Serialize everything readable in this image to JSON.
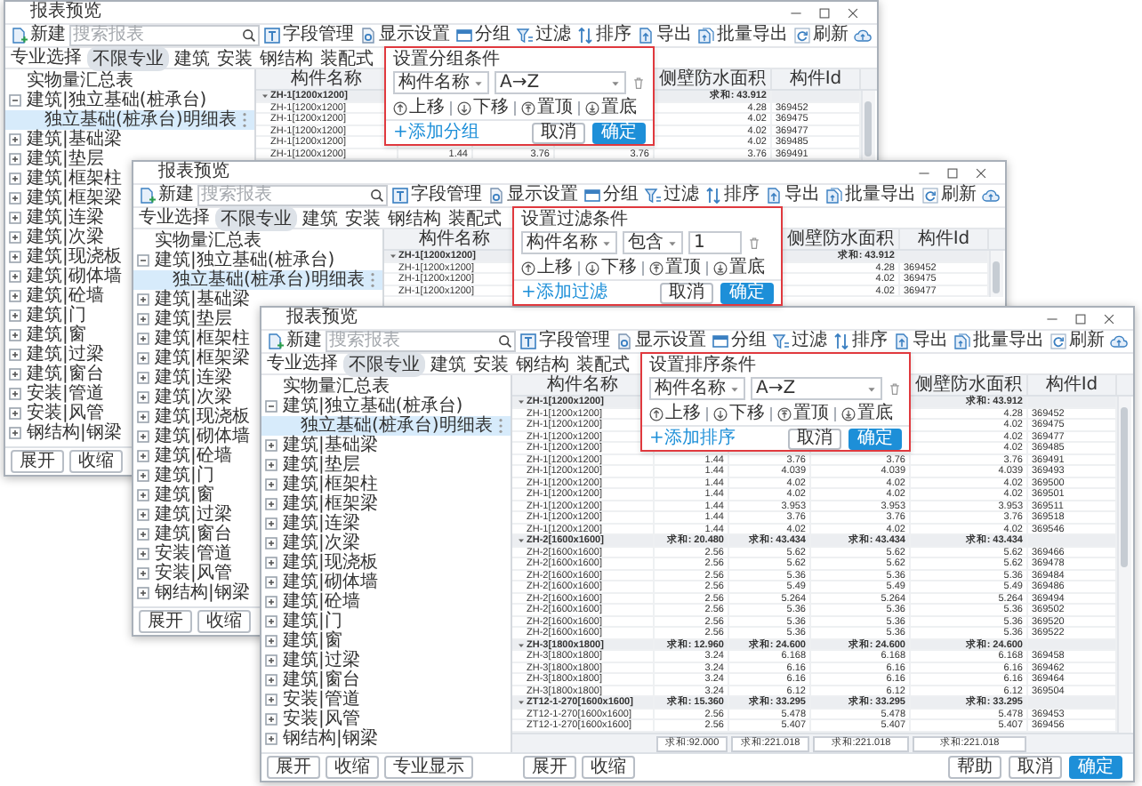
{
  "windows": [
    {
      "title": "报表预览",
      "toolbar": {
        "new_label": "新建",
        "search_placeholder": "搜索报表",
        "buttons": [
          {
            "kind": "fields",
            "label": "字段管理"
          },
          {
            "kind": "display",
            "label": "显示设置"
          },
          {
            "kind": "group",
            "label": "分组"
          },
          {
            "kind": "filter",
            "label": "过滤"
          },
          {
            "kind": "sort",
            "label": "排序"
          },
          {
            "kind": "export",
            "label": "导出"
          },
          {
            "kind": "batch_export",
            "label": "批量导出"
          },
          {
            "kind": "refresh",
            "label": "刷新"
          },
          {
            "kind": "upload"
          }
        ]
      },
      "discipline_label": "专业选择",
      "tabs": [
        {
          "label": "不限专业",
          "selected": true
        },
        {
          "label": "建筑",
          "selected": false
        },
        {
          "label": "安装",
          "selected": false
        },
        {
          "label": "钢结构",
          "selected": false
        },
        {
          "label": "装配式",
          "selected": false
        }
      ],
      "tree": [
        {
          "label": "实物量汇总表",
          "selected": false
        },
        {
          "label": "建筑|独立基础(桩承台)",
          "selected": false,
          "expanded": true,
          "children": [
            {
              "label": "独立基础(桩承台)明细表",
              "selected": true
            }
          ]
        },
        {
          "label": "建筑|基础梁",
          "selected": false,
          "expanded": false
        },
        {
          "label": "建筑|垫层",
          "selected": false,
          "expanded": false
        },
        {
          "label": "建筑|框架柱",
          "selected": false,
          "expanded": false
        },
        {
          "label": "建筑|框架梁",
          "selected": false,
          "expanded": false
        },
        {
          "label": "建筑|连梁",
          "selected": false,
          "expanded": false
        },
        {
          "label": "建筑|次梁",
          "selected": false,
          "expanded": false
        },
        {
          "label": "建筑|现浇板",
          "selected": false,
          "expanded": false
        },
        {
          "label": "建筑|砌体墙",
          "selected": false,
          "expanded": false
        },
        {
          "label": "建筑|砼墙",
          "selected": false,
          "expanded": false
        },
        {
          "label": "建筑|门",
          "selected": false,
          "expanded": false
        },
        {
          "label": "建筑|窗",
          "selected": false,
          "expanded": false
        },
        {
          "label": "建筑|过梁",
          "selected": false,
          "expanded": false
        },
        {
          "label": "建筑|窗台",
          "selected": false,
          "expanded": false
        },
        {
          "label": "安装|管道",
          "selected": false,
          "expanded": false
        },
        {
          "label": "安装|风管",
          "selected": false,
          "expanded": false
        },
        {
          "label": "钢结构|钢梁",
          "selected": false,
          "expanded": false
        }
      ],
      "table": {
        "columns": [
          "构件名称",
          null,
          null,
          null,
          "侧壁防水面积",
          "构件Id"
        ],
        "rows": [
          {
            "kind": "group",
            "cells": [
              "ZH-1[1200x1200]",
              null,
              null,
              null,
              "求和: 43.912",
              null
            ]
          },
          {
            "kind": "item",
            "cells": [
              "ZH-1[1200x1200]",
              null,
              null,
              null,
              "4.28",
              "369452"
            ]
          },
          {
            "kind": "item",
            "cells": [
              "ZH-1[1200x1200]",
              null,
              null,
              null,
              "4.02",
              "369475"
            ]
          },
          {
            "kind": "item",
            "cells": [
              "ZH-1[1200x1200]",
              null,
              null,
              null,
              "4.02",
              "369477"
            ]
          },
          {
            "kind": "item",
            "cells": [
              "ZH-1[1200x1200]",
              null,
              null,
              null,
              "4.02",
              "369485"
            ]
          },
          {
            "kind": "item",
            "cells": [
              "ZH-1[1200x1200]",
              "1.44",
              "3.76",
              "3.76",
              "3.76",
              "369491"
            ]
          }
        ]
      },
      "popup": {
        "kind": "group",
        "title": "设置分组条件",
        "field": "构件名称",
        "order": "A→Z",
        "actions": [
          "上移",
          "下移",
          "置顶",
          "置底"
        ],
        "add_link": "+添加分组",
        "cancel": "取消",
        "confirm": "确定"
      },
      "bottom_buttons": {
        "tree": [
          "展开",
          "收缩"
        ]
      }
    },
    {
      "title": "报表预览",
      "toolbar": {
        "new_label": "新建",
        "search_placeholder": "搜索报表",
        "buttons": [
          {
            "kind": "fields",
            "label": "字段管理"
          },
          {
            "kind": "display",
            "label": "显示设置"
          },
          {
            "kind": "group",
            "label": "分组"
          },
          {
            "kind": "filter",
            "label": "过滤"
          },
          {
            "kind": "sort",
            "label": "排序"
          },
          {
            "kind": "export",
            "label": "导出"
          },
          {
            "kind": "batch_export",
            "label": "批量导出"
          },
          {
            "kind": "refresh",
            "label": "刷新"
          },
          {
            "kind": "upload"
          }
        ]
      },
      "discipline_label": "专业选择",
      "tabs": [
        {
          "label": "不限专业",
          "selected": true
        },
        {
          "label": "建筑",
          "selected": false
        },
        {
          "label": "安装",
          "selected": false
        },
        {
          "label": "钢结构",
          "selected": false
        },
        {
          "label": "装配式",
          "selected": false
        }
      ],
      "tree": [
        {
          "label": "实物量汇总表",
          "selected": false
        },
        {
          "label": "建筑|独立基础(桩承台)",
          "selected": false,
          "expanded": true,
          "children": [
            {
              "label": "独立基础(桩承台)明细表",
              "selected": true
            }
          ]
        },
        {
          "label": "建筑|基础梁",
          "selected": false,
          "expanded": false
        },
        {
          "label": "建筑|垫层",
          "selected": false,
          "expanded": false
        },
        {
          "label": "建筑|框架柱",
          "selected": false,
          "expanded": false
        },
        {
          "label": "建筑|框架梁",
          "selected": false,
          "expanded": false
        },
        {
          "label": "建筑|连梁",
          "selected": false,
          "expanded": false
        },
        {
          "label": "建筑|次梁",
          "selected": false,
          "expanded": false
        },
        {
          "label": "建筑|现浇板",
          "selected": false,
          "expanded": false
        },
        {
          "label": "建筑|砌体墙",
          "selected": false,
          "expanded": false
        },
        {
          "label": "建筑|砼墙",
          "selected": false,
          "expanded": false
        },
        {
          "label": "建筑|门",
          "selected": false,
          "expanded": false
        },
        {
          "label": "建筑|窗",
          "selected": false,
          "expanded": false
        },
        {
          "label": "建筑|过梁",
          "selected": false,
          "expanded": false
        },
        {
          "label": "建筑|窗台",
          "selected": false,
          "expanded": false
        },
        {
          "label": "安装|管道",
          "selected": false,
          "expanded": false
        },
        {
          "label": "安装|风管",
          "selected": false,
          "expanded": false
        },
        {
          "label": "钢结构|钢梁",
          "selected": false,
          "expanded": false
        }
      ],
      "table": {
        "columns": [
          "构件名称",
          null,
          null,
          null,
          "侧壁防水面积",
          "构件Id"
        ],
        "rows": [
          {
            "kind": "group",
            "cells": [
              "ZH-1[1200x1200]",
              null,
              null,
              null,
              "求和: 43.912",
              null
            ]
          },
          {
            "kind": "item",
            "cells": [
              "ZH-1[1200x1200]",
              null,
              null,
              null,
              "4.28",
              "369452"
            ]
          },
          {
            "kind": "item",
            "cells": [
              "ZH-1[1200x1200]",
              null,
              null,
              null,
              "4.02",
              "369475"
            ]
          },
          {
            "kind": "item",
            "cells": [
              "ZH-1[1200x1200]",
              null,
              null,
              null,
              "4.02",
              "369477"
            ]
          }
        ]
      },
      "popup": {
        "kind": "filter",
        "title": "设置过滤条件",
        "field": "构件名称",
        "operator": "包含",
        "value": "1",
        "actions": [
          "上移",
          "下移",
          "置顶",
          "置底"
        ],
        "add_link": "+添加过滤",
        "cancel": "取消",
        "confirm": "确定"
      },
      "bottom_buttons": {
        "tree": [
          "展开",
          "收缩"
        ]
      }
    },
    {
      "title": "报表预览",
      "toolbar": {
        "new_label": "新建",
        "search_placeholder": "搜索报表",
        "buttons": [
          {
            "kind": "fields",
            "label": "字段管理"
          },
          {
            "kind": "display",
            "label": "显示设置"
          },
          {
            "kind": "group",
            "label": "分组"
          },
          {
            "kind": "filter",
            "label": "过滤"
          },
          {
            "kind": "sort",
            "label": "排序"
          },
          {
            "kind": "export",
            "label": "导出"
          },
          {
            "kind": "batch_export",
            "label": "批量导出"
          },
          {
            "kind": "refresh",
            "label": "刷新"
          },
          {
            "kind": "upload"
          }
        ]
      },
      "discipline_label": "专业选择",
      "tabs": [
        {
          "label": "不限专业",
          "selected": true
        },
        {
          "label": "建筑",
          "selected": false
        },
        {
          "label": "安装",
          "selected": false
        },
        {
          "label": "钢结构",
          "selected": false
        },
        {
          "label": "装配式",
          "selected": false
        }
      ],
      "tree": [
        {
          "label": "实物量汇总表",
          "selected": false
        },
        {
          "label": "建筑|独立基础(桩承台)",
          "selected": false,
          "expanded": true,
          "children": [
            {
              "label": "独立基础(桩承台)明细表",
              "selected": true
            }
          ]
        },
        {
          "label": "建筑|基础梁",
          "selected": false,
          "expanded": false
        },
        {
          "label": "建筑|垫层",
          "selected": false,
          "expanded": false
        },
        {
          "label": "建筑|框架柱",
          "selected": false,
          "expanded": false
        },
        {
          "label": "建筑|框架梁",
          "selected": false,
          "expanded": false
        },
        {
          "label": "建筑|连梁",
          "selected": false,
          "expanded": false
        },
        {
          "label": "建筑|次梁",
          "selected": false,
          "expanded": false
        },
        {
          "label": "建筑|现浇板",
          "selected": false,
          "expanded": false
        },
        {
          "label": "建筑|砌体墙",
          "selected": false,
          "expanded": false
        },
        {
          "label": "建筑|砼墙",
          "selected": false,
          "expanded": false
        },
        {
          "label": "建筑|门",
          "selected": false,
          "expanded": false
        },
        {
          "label": "建筑|窗",
          "selected": false,
          "expanded": false
        },
        {
          "label": "建筑|过梁",
          "selected": false,
          "expanded": false
        },
        {
          "label": "建筑|窗台",
          "selected": false,
          "expanded": false
        },
        {
          "label": "安装|管道",
          "selected": false,
          "expanded": false
        },
        {
          "label": "安装|风管",
          "selected": false,
          "expanded": false
        },
        {
          "label": "钢结构|钢梁",
          "selected": false,
          "expanded": false
        }
      ],
      "table": {
        "columns": [
          "构件名称",
          null,
          null,
          null,
          "侧壁防水面积",
          "构件Id"
        ],
        "rows": [
          {
            "kind": "group",
            "cells": [
              "ZH-1[1200x1200]",
              null,
              null,
              null,
              "求和: 43.912",
              null
            ]
          },
          {
            "kind": "item",
            "cells": [
              "ZH-1[1200x1200]",
              null,
              null,
              null,
              "4.28",
              "369452"
            ]
          },
          {
            "kind": "item",
            "cells": [
              "ZH-1[1200x1200]",
              null,
              null,
              null,
              "4.02",
              "369475"
            ]
          },
          {
            "kind": "item",
            "cells": [
              "ZH-1[1200x1200]",
              null,
              null,
              null,
              "4.02",
              "369477"
            ]
          },
          {
            "kind": "item",
            "cells": [
              "ZH-1[1200x1200]",
              null,
              null,
              null,
              "4.02",
              "369485"
            ]
          },
          {
            "kind": "item",
            "cells": [
              "ZH-1[1200x1200]",
              "1.44",
              "3.76",
              "3.76",
              "3.76",
              "369491"
            ]
          },
          {
            "kind": "item",
            "cells": [
              "ZH-1[1200x1200]",
              "1.44",
              "4.039",
              "4.039",
              "4.039",
              "369493"
            ]
          },
          {
            "kind": "item",
            "cells": [
              "ZH-1[1200x1200]",
              "1.44",
              "4.02",
              "4.02",
              "4.02",
              "369500"
            ]
          },
          {
            "kind": "item",
            "cells": [
              "ZH-1[1200x1200]",
              "1.44",
              "4.02",
              "4.02",
              "4.02",
              "369501"
            ]
          },
          {
            "kind": "item",
            "cells": [
              "ZH-1[1200x1200]",
              "1.44",
              "3.953",
              "3.953",
              "3.953",
              "369511"
            ]
          },
          {
            "kind": "item",
            "cells": [
              "ZH-1[1200x1200]",
              "1.44",
              "3.76",
              "3.76",
              "3.76",
              "369518"
            ]
          },
          {
            "kind": "item",
            "cells": [
              "ZH-1[1200x1200]",
              "1.44",
              "4.02",
              "4.02",
              "4.02",
              "369546"
            ]
          },
          {
            "kind": "group",
            "cells": [
              "ZH-2[1600x1600]",
              "求和: 20.480",
              "求和: 43.434",
              "求和: 43.434",
              "求和: 43.434",
              null
            ]
          },
          {
            "kind": "item",
            "cells": [
              "ZH-2[1600x1600]",
              "2.56",
              "5.62",
              "5.62",
              "5.62",
              "369466"
            ]
          },
          {
            "kind": "item",
            "cells": [
              "ZH-2[1600x1600]",
              "2.56",
              "5.62",
              "5.62",
              "5.62",
              "369478"
            ]
          },
          {
            "kind": "item",
            "cells": [
              "ZH-2[1600x1600]",
              "2.56",
              "5.36",
              "5.36",
              "5.36",
              "369484"
            ]
          },
          {
            "kind": "item",
            "cells": [
              "ZH-2[1600x1600]",
              "2.56",
              "5.49",
              "5.49",
              "5.49",
              "369486"
            ]
          },
          {
            "kind": "item",
            "cells": [
              "ZH-2[1600x1600]",
              "2.56",
              "5.264",
              "5.264",
              "5.264",
              "369494"
            ]
          },
          {
            "kind": "item",
            "cells": [
              "ZH-2[1600x1600]",
              "2.56",
              "5.36",
              "5.36",
              "5.36",
              "369502"
            ]
          },
          {
            "kind": "item",
            "cells": [
              "ZH-2[1600x1600]",
              "2.56",
              "5.36",
              "5.36",
              "5.36",
              "369520"
            ]
          },
          {
            "kind": "item",
            "cells": [
              "ZH-2[1600x1600]",
              "2.56",
              "5.36",
              "5.36",
              "5.36",
              "369522"
            ]
          },
          {
            "kind": "group",
            "cells": [
              "ZH-3[1800x1800]",
              "求和: 12.960",
              "求和: 24.600",
              "求和: 24.600",
              "求和: 24.600",
              null
            ]
          },
          {
            "kind": "item",
            "cells": [
              "ZH-3[1800x1800]",
              "3.24",
              "6.168",
              "6.168",
              "6.168",
              "369458"
            ]
          },
          {
            "kind": "item",
            "cells": [
              "ZH-3[1800x1800]",
              "3.24",
              "6.16",
              "6.16",
              "6.16",
              "369462"
            ]
          },
          {
            "kind": "item",
            "cells": [
              "ZH-3[1800x1800]",
              "3.24",
              "6.16",
              "6.16",
              "6.16",
              "369464"
            ]
          },
          {
            "kind": "item",
            "cells": [
              "ZH-3[1800x1800]",
              "3.24",
              "6.12",
              "6.12",
              "6.12",
              "369504"
            ]
          },
          {
            "kind": "group",
            "cells": [
              "ZT12-1-270[1600x1600]",
              "求和: 15.360",
              "求和: 33.295",
              "求和: 33.295",
              "求和: 33.295",
              null
            ]
          },
          {
            "kind": "item",
            "cells": [
              "ZT12-1-270[1600x1600]",
              "2.56",
              "5.478",
              "5.478",
              "5.478",
              "369453"
            ]
          },
          {
            "kind": "item",
            "cells": [
              "ZT12-1-270[1600x1600]",
              "2.56",
              "5.407",
              "5.407",
              "5.407",
              "369456"
            ]
          }
        ],
        "footer": [
          "求和:92.000",
          "求和:221.018",
          "求和:221.018",
          "求和:221.018"
        ]
      },
      "popup": {
        "kind": "sort",
        "title": "设置排序条件",
        "field": "构件名称",
        "order": "A→Z",
        "actions": [
          "上移",
          "下移",
          "置顶",
          "置底"
        ],
        "add_link": "+添加排序",
        "cancel": "取消",
        "confirm": "确定"
      },
      "bottom_buttons": {
        "tree": [
          "展开",
          "收缩",
          "专业显示"
        ],
        "table": [
          "展开",
          "收缩"
        ],
        "dialog": [
          {
            "label": "帮助",
            "primary": false
          },
          {
            "label": "取消",
            "primary": false
          },
          {
            "label": "确定",
            "primary": true
          }
        ]
      }
    }
  ]
}
